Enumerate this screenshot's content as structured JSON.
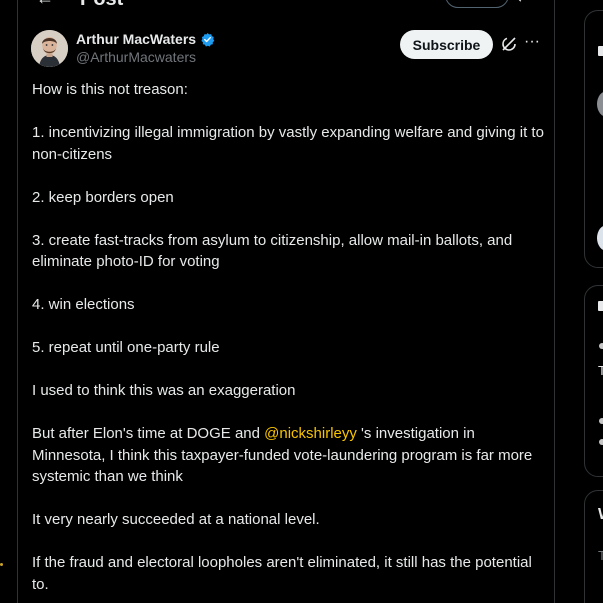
{
  "header": {
    "title": "Post",
    "back_arrow": "←",
    "reply_icon": "↩"
  },
  "post": {
    "author": {
      "name": "Arthur MacWaters",
      "handle": "@ArthurMacwaters",
      "verified_color": "#1d9bf0"
    },
    "subscribe_label": "Subscribe",
    "more_icon": "···",
    "paragraphs": [
      "How is this not treason:",
      "1. incentivizing illegal immigration by vastly expanding welfare and giving it to non-citizens",
      "2. keep borders open",
      "3. create fast-tracks from asylum to citizenship, allow mail-in ballots, and eliminate photo-ID for voting",
      "4. win elections",
      "5. repeat until one-party rule",
      "I used to think this was an exaggeration"
    ],
    "mention_paragraph": {
      "before": "But after Elon's time at DOGE and ",
      "mention": "@nickshirleyy",
      "after": " 's investigation in Minnesota, I think this taxpayer-funded vote-laundering program is far more systemic than we think"
    },
    "closing_paragraphs": [
      "It very nearly succeeded at a national level.",
      "If the fraud and electoral loopholes aren't eliminated, it still has the potential to."
    ]
  },
  "sidebar_fragments": {
    "letters": [
      "T",
      "W",
      "T"
    ]
  },
  "colors": {
    "background": "#000000",
    "text": "#e7e9ea",
    "muted": "#71767b",
    "border": "#2f3336",
    "mention": "#f7c300",
    "button_bg": "#eff3f4"
  },
  "icons": {
    "verified": "verified-badge-icon",
    "grok": "grok-icon",
    "more": "more-icon"
  }
}
